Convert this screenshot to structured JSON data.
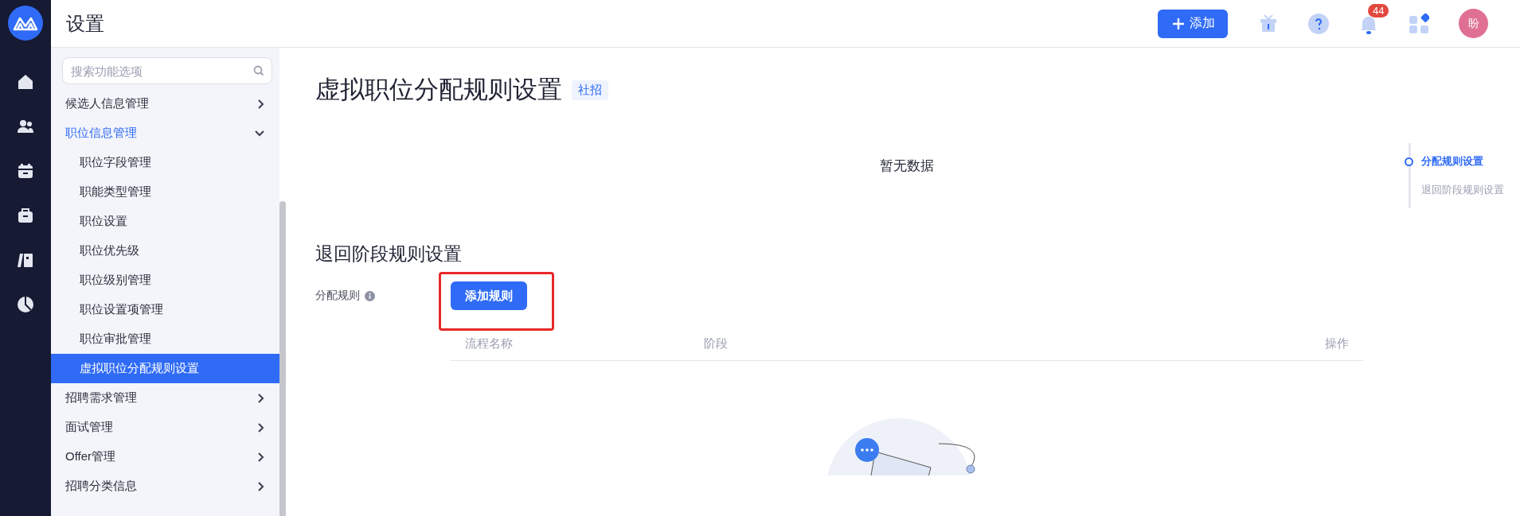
{
  "header": {
    "title": "设置",
    "add_button": "添加",
    "notification_count": "44",
    "avatar": "盼"
  },
  "sidebar": {
    "search": {
      "placeholder": "搜索功能选项"
    },
    "items": [
      {
        "label": "候选人信息管理",
        "expanded": false
      },
      {
        "label": "职位信息管理",
        "expanded": true,
        "children": [
          {
            "label": "职位字段管理",
            "selected": false
          },
          {
            "label": "职能类型管理",
            "selected": false
          },
          {
            "label": "职位设置",
            "selected": false
          },
          {
            "label": "职位优先级",
            "selected": false
          },
          {
            "label": "职位级别管理",
            "selected": false
          },
          {
            "label": "职位设置项管理",
            "selected": false
          },
          {
            "label": "职位审批管理",
            "selected": false
          },
          {
            "label": "虚拟职位分配规则设置",
            "selected": true
          }
        ]
      },
      {
        "label": "招聘需求管理",
        "expanded": false
      },
      {
        "label": "面试管理",
        "expanded": false
      },
      {
        "label": "Offer管理",
        "expanded": false
      },
      {
        "label": "招聘分类信息",
        "expanded": false
      }
    ]
  },
  "page": {
    "title": "虚拟职位分配规则设置",
    "tag": "社招",
    "first_section": {
      "empty_text": "暂无数据"
    },
    "second_section": {
      "title": "退回阶段规则设置",
      "field_label": "分配规则",
      "add_rule_button": "添加规则",
      "highlighted": true,
      "columns": [
        "流程名称",
        "阶段",
        "操作"
      ]
    }
  },
  "anchor_nav": [
    {
      "label": "分配规则设置",
      "selected": true
    },
    {
      "label": "退回阶段规则设置",
      "selected": false
    }
  ]
}
